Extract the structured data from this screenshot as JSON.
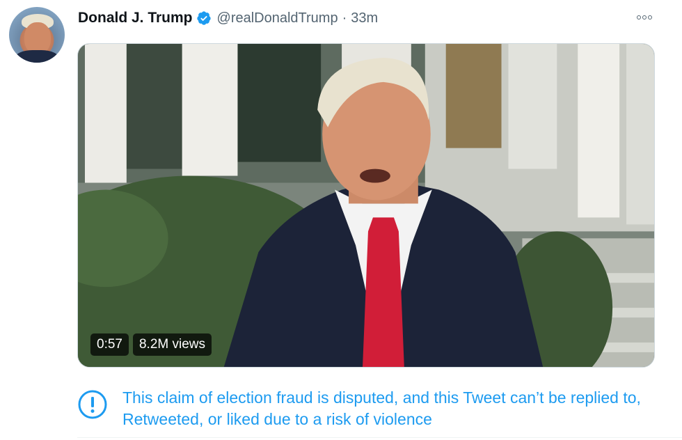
{
  "author": {
    "display_name": "Donald J. Trump",
    "handle": "@realDonaldTrump",
    "separator": "·",
    "time": "33m",
    "verified": true
  },
  "media": {
    "type": "video",
    "duration": "0:57",
    "views": "8.2M views"
  },
  "notice": {
    "text": "This claim of election fraud is disputed, and this Tweet can’t be replied to, Retweeted, or liked due to a risk of violence"
  },
  "icons": {
    "more": "more-horizontal-icon",
    "verified": "verified-badge-icon",
    "notice": "exclamation-circle-icon"
  },
  "colors": {
    "accent": "#1d9bf0",
    "text_primary": "#0f1419",
    "text_secondary": "#536471"
  }
}
